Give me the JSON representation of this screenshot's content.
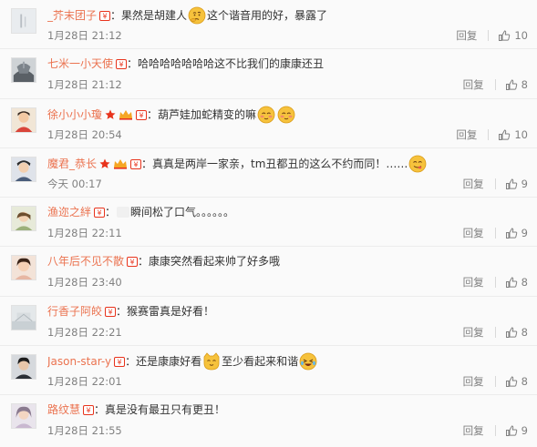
{
  "colors": {
    "username": "#eb7350",
    "text": "#333333",
    "meta": "#808080",
    "badge": "#e8331c",
    "star": "#e8331c"
  },
  "reply_label": "回复",
  "colon": "：",
  "comments": [
    {
      "user": "_芥末团子",
      "text_a": "果然是胡建人",
      "text_b": "这个谐音用的好，暴露了",
      "time": "1月28日 21:12",
      "likes": "10"
    },
    {
      "user": "七米一小天使",
      "text_a": "哈哈哈哈哈哈哈这不比我们的康康还丑",
      "text_b": "",
      "time": "1月28日 21:12",
      "likes": "8"
    },
    {
      "user": "徐小小小瓊",
      "text_a": "葫芦娃加蛇精变的嘛",
      "text_b": "",
      "time": "1月28日 20:54",
      "likes": "10"
    },
    {
      "user": "魔君_恭长",
      "text_a": "真真是两岸一家亲，tm丑都丑的这么不约而同！……",
      "text_b": "",
      "time": "今天 00:17",
      "likes": "9"
    },
    {
      "user": "渔迩之絆",
      "text_a": "瞬间松了口气。。。。。。",
      "text_b": "",
      "time": "1月28日 22:11",
      "likes": "9"
    },
    {
      "user": "八年后不见不散",
      "text_a": "康康突然看起来帅了好多哦",
      "text_b": "",
      "time": "1月28日 23:40",
      "likes": "8"
    },
    {
      "user": "行香子阿皎",
      "text_a": "猴赛雷真是好看！",
      "text_b": "",
      "time": "1月28日 22:21",
      "likes": "8"
    },
    {
      "user": "Jason-star-y",
      "text_a": "还是康康好看",
      "text_b": "至少看起来和谐",
      "time": "1月28日 22:01",
      "likes": "8"
    },
    {
      "user": "路纹慧",
      "text_a": "真是没有最丑只有更丑！",
      "text_b": "",
      "time": "1月28日 21:55",
      "likes": "9"
    }
  ]
}
